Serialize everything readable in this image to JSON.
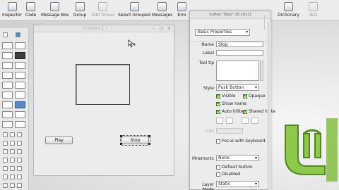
{
  "toolbar": {
    "items": [
      {
        "label": "Inspector",
        "icon": "inspector-icon",
        "enabled": true
      },
      {
        "label": "Code",
        "icon": "code-icon",
        "enabled": true
      },
      {
        "label": "Message Box",
        "icon": "message-box-icon",
        "enabled": true
      },
      {
        "label": "Group",
        "icon": "group-icon",
        "enabled": true
      },
      {
        "label": "Edit Group",
        "icon": "edit-group-icon",
        "enabled": false
      },
      {
        "label": "Select Grouped",
        "icon": "select-grouped-icon",
        "enabled": true
      },
      {
        "label": "Messages",
        "icon": "messages-icon",
        "enabled": true
      },
      {
        "label": "Erro",
        "icon": "errors-icon",
        "enabled": true
      },
      {
        "label": "Dictionary",
        "icon": "dictionary-icon",
        "enabled": true
      },
      {
        "label": "Test",
        "icon": "test-icon",
        "enabled": false
      }
    ]
  },
  "stack_window": {
    "title": "Untitled 1 *",
    "play_label": "Play",
    "stop_label": "Stop"
  },
  "inspector": {
    "title": "button \"Stop\" (ID 1011)",
    "section": "Basic Properties",
    "name_label": "Name",
    "name_value": "Stop",
    "label_label": "Label",
    "label_value": "",
    "tooltip_label": "Tool tip",
    "style_label": "Style",
    "style_value": "Push Button",
    "visible_label": "Visible",
    "opaque_label": "Opaque",
    "show_name_label": "Show name",
    "auto_hilite_label": "Auto hilite",
    "shared_hilite_label": "Shared hilite",
    "icon_label": "Icon",
    "focus_label": "Focus with keyboard",
    "mnemonic_label": "Mnemonic",
    "mnemonic_value": "None",
    "default_button_label": "Default button",
    "disabled_label": "Disabled",
    "layer_mode_label": "Layer Mode",
    "layer_mode_value": "Static"
  },
  "colors": {
    "check_on": "#6fae3c",
    "mint_green": "#86c440"
  }
}
